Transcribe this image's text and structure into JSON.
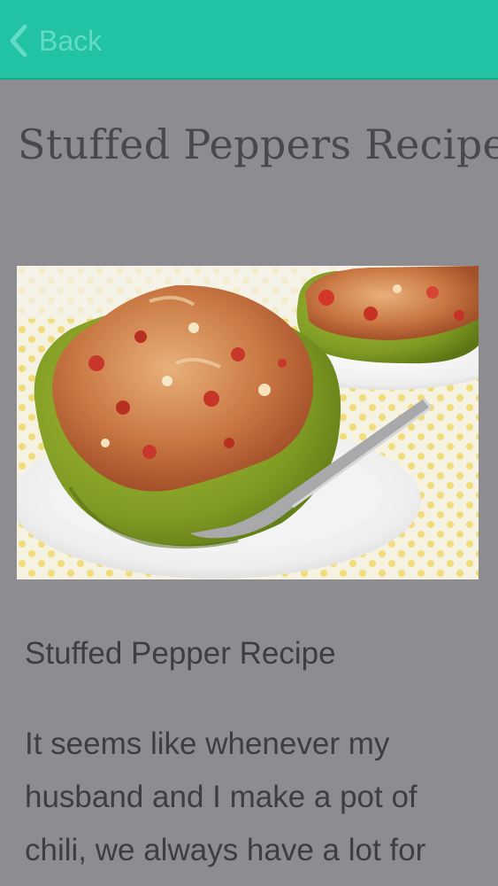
{
  "header": {
    "back_label": "Back",
    "accent_color": "#22c2a5"
  },
  "page": {
    "title": "Stuffed Peppers Recipe",
    "subtitle": "Stuffed Pepper Recipe",
    "intro_text": "It seems like whenever my husband and I make a pot of chili, we always have a lot for",
    "background_color": "#8d8c90"
  },
  "icons": {
    "back": "chevron-left-icon"
  }
}
